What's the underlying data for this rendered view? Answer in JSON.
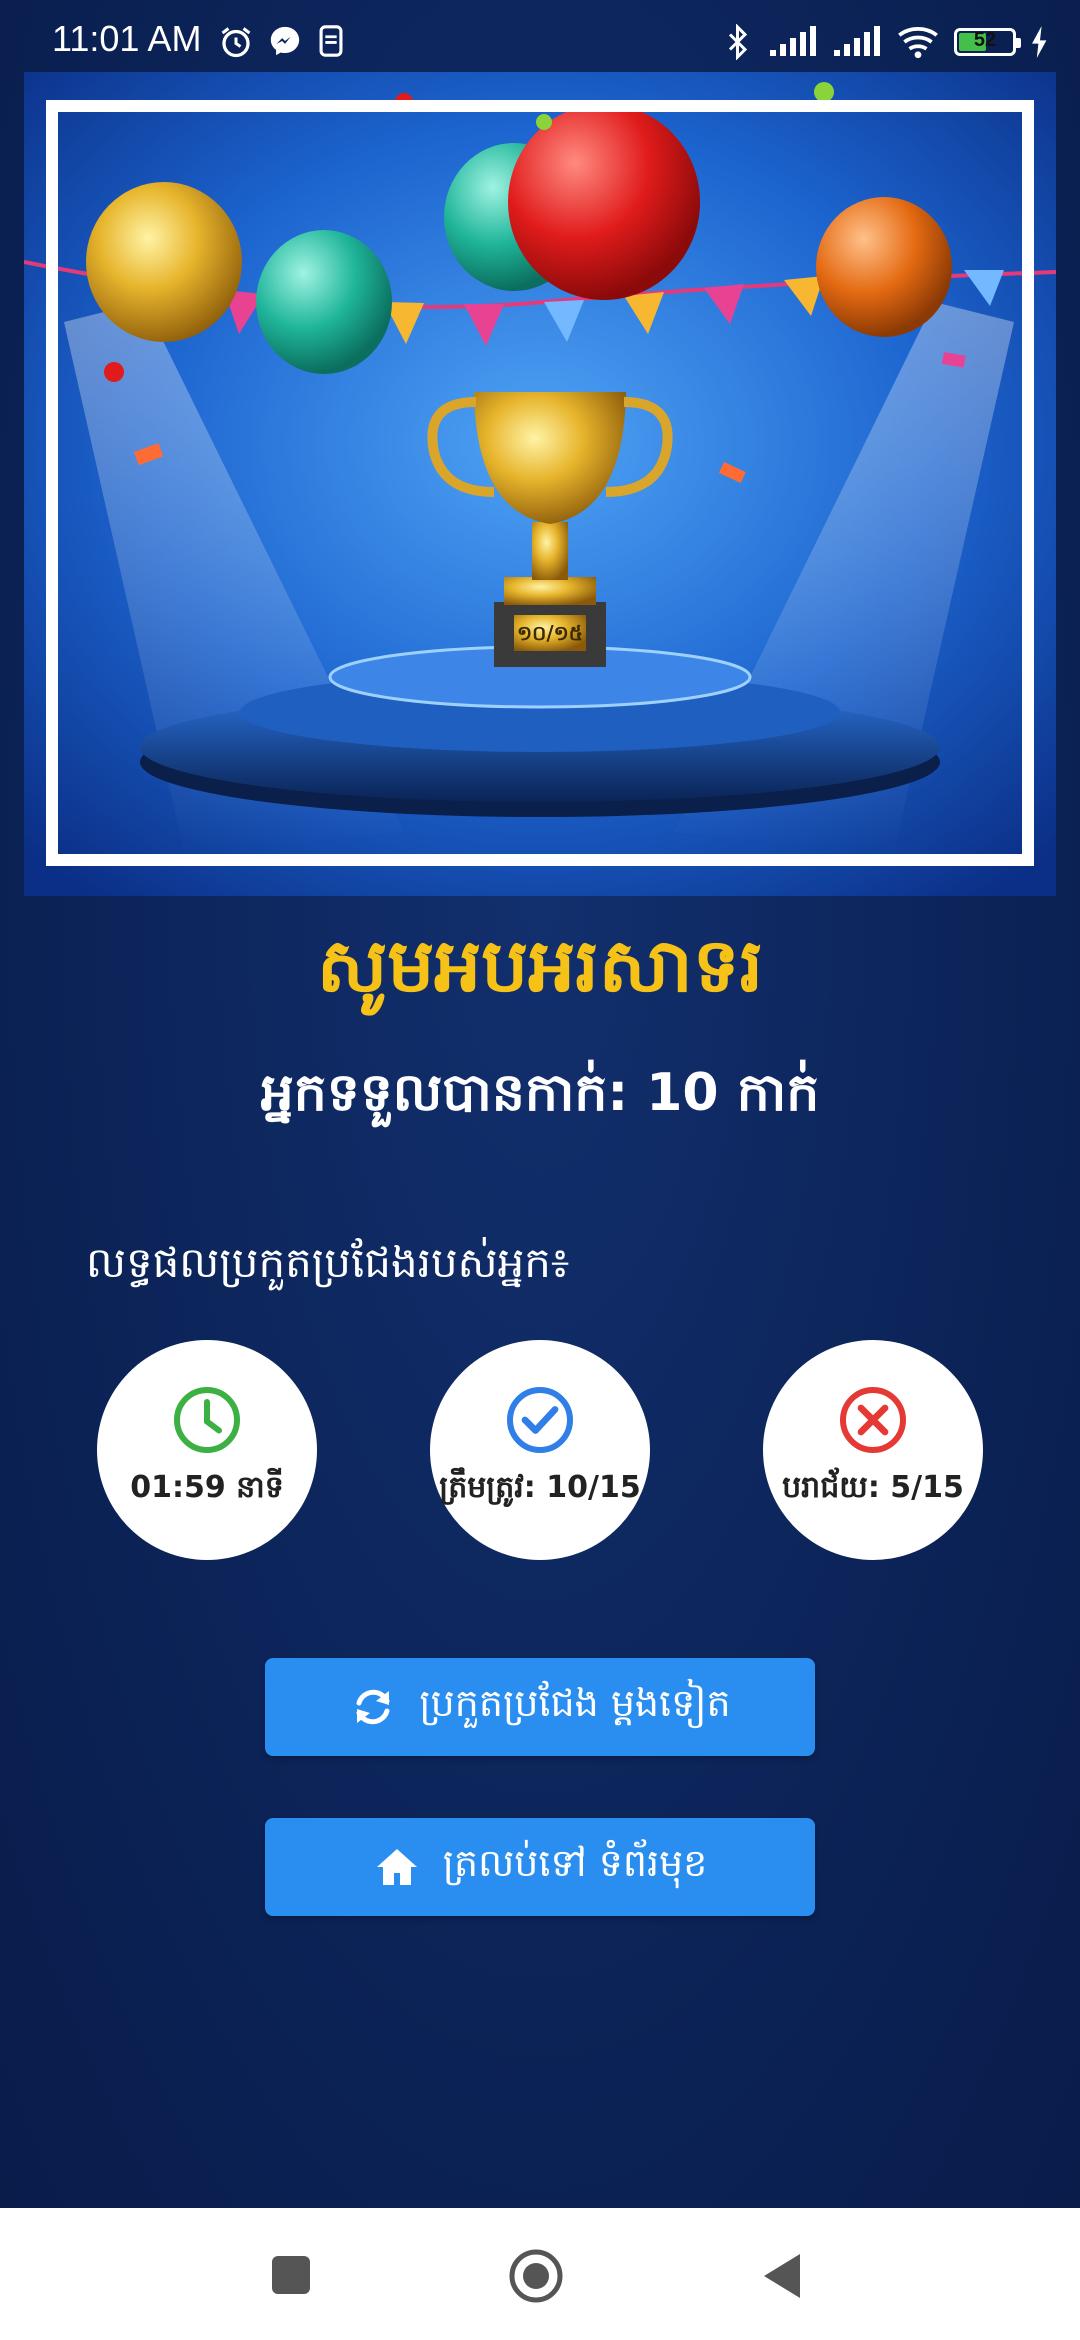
{
  "status_bar": {
    "time": "11:01 AM",
    "battery": "52",
    "battery_level": 0.52,
    "icons": [
      "alarm-icon",
      "messenger-icon",
      "notification-icon",
      "bluetooth-icon",
      "signal-icon",
      "signal-icon",
      "wifi-icon",
      "battery-icon",
      "charging-icon"
    ]
  },
  "hero": {
    "trophy_plate": "១០/១៥"
  },
  "main": {
    "title": "សូមអបអរសាទរ",
    "subtitle": "អ្នកទទួលបានកាក់: 10 កាក់",
    "results_label": "លទ្ធផលប្រកួតប្រជែងរបស់អ្នក៖"
  },
  "stats": [
    {
      "text": "01:59 នាទី",
      "icon": "clock-icon",
      "color": "#3cb043"
    },
    {
      "text": "ត្រឹមត្រូវ: 10/15",
      "icon": "check-circle-icon",
      "color": "#2f7fe6"
    },
    {
      "text": "បរាជ័យ: 5/15",
      "icon": "x-circle-icon",
      "color": "#e53935"
    }
  ],
  "buttons": {
    "retry_label": "ប្រកួតប្រជែង ម្តងទៀត",
    "home_label": "ត្រលប់ទៅ ទំព័រមុខ"
  },
  "colors": {
    "accent": "#2a8ef0",
    "title": "#f6c217",
    "background": "#0c2459"
  },
  "nav": {
    "icons": [
      "recents-square-icon",
      "home-circle-icon",
      "back-triangle-icon"
    ]
  }
}
